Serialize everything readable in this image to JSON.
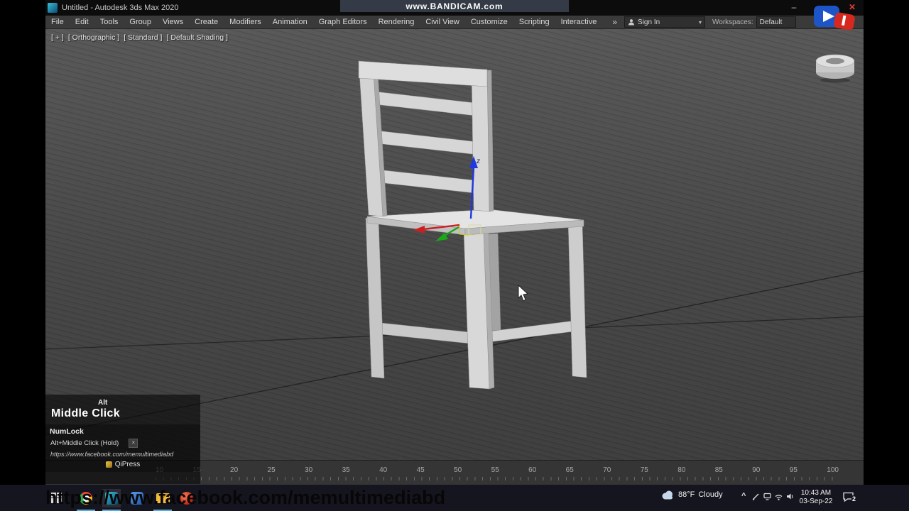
{
  "recording_banner": {
    "text": "www.BANDICAM.com"
  },
  "titlebar": {
    "title": "Untitled - Autodesk 3ds Max 2020",
    "minimize_glyph": "–",
    "close_glyph": "✕"
  },
  "menubar": {
    "items": [
      "File",
      "Edit",
      "Tools",
      "Group",
      "Views",
      "Create",
      "Modifiers",
      "Animation",
      "Graph Editors",
      "Rendering",
      "Civil View",
      "Customize",
      "Scripting",
      "Interactive"
    ],
    "overflow_glyph": "»",
    "caret_glyph": "▾",
    "sign_in_label": "Sign In",
    "workspaces_label": "Workspaces:",
    "workspace_value": "Default"
  },
  "viewport": {
    "label_plus": "[ + ]",
    "label_view": "[ Orthographic ]",
    "label_renderer": "[ Standard ]",
    "label_shading": "[ Default Shading ]",
    "gizmo_z_label": "z"
  },
  "qipress": {
    "modifier_key": "Alt",
    "action_label": "Middle Click",
    "lock_key": "NumLock",
    "history_entry": "Alt+Middle Click (Hold)",
    "close_glyph": "×",
    "url": "https://www.facebook.com/memultimediabd",
    "app_name": "QiPress"
  },
  "timeline": {
    "ticks": [
      "10",
      "15",
      "20",
      "25",
      "30",
      "35",
      "40",
      "45",
      "50",
      "55",
      "60",
      "65",
      "70",
      "75",
      "80",
      "85",
      "90",
      "95",
      "100"
    ]
  },
  "watermark": {
    "url": "https://www.facebook.com/memultimediabd"
  },
  "taskbar": {
    "weather_temp": "88°F",
    "weather_desc": "Cloudy",
    "tray_expand_glyph": "^",
    "time": "10:43 AM",
    "date": "03-Sep-22",
    "notification_count": "2"
  },
  "colors": {
    "axis_x": "#cc2020",
    "axis_y": "#18a818",
    "axis_z": "#2038e0",
    "taskbar_underline": "#58aee0"
  }
}
